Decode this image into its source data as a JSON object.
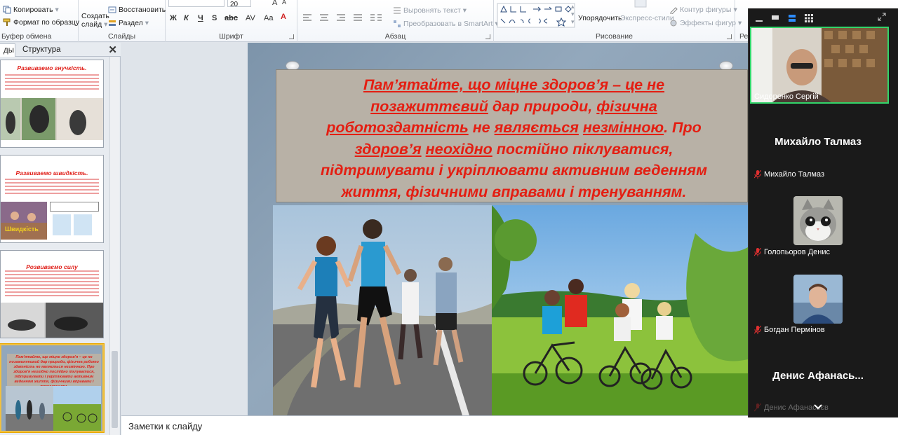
{
  "ribbon": {
    "clipboard": {
      "copy": "Копировать",
      "format_painter": "Формат по образцу",
      "label": "Буфер обмена"
    },
    "slides": {
      "new_slide": "Создать",
      "new_slide_2": "слайд",
      "restore": "Восстановить",
      "section": "Раздел",
      "label": "Слайды"
    },
    "font": {
      "size": "20",
      "label": "Шрифт"
    },
    "paragraph": {
      "align_text": "Выровнять текст",
      "convert_smartart": "Преобразовать в SmartArt",
      "label": "Абзац"
    },
    "drawing": {
      "arrange": "Упорядочить",
      "quick_styles": "Экспресс-стили",
      "shape_outline": "Контур фигуры",
      "shape_effects": "Эффекты фигур",
      "label": "Рисование"
    },
    "editing": {
      "label": "Ре"
    }
  },
  "left_panel": {
    "tab_slides": "ды",
    "tab_outline": "Структура",
    "thumbnails": [
      {
        "title": "Развиваемо гнучкість."
      },
      {
        "title": "Развиваемо швидкість.",
        "caption": "Швидкість"
      },
      {
        "title": "Розвиваємо силу"
      },
      {
        "title": "Пам'ятайте, що міцне здоров'я – це не позажиттєвий дар природи, фізична робото здатність не являється незмінною. Про здоров'я неохідно постійно піклуватися, підтримувати і укріплювати активним веденням життя, фізичними вправами і тренуванням."
      }
    ]
  },
  "slide": {
    "line1_a": "Пам’ятайте, що міцне здоров’я – це не",
    "line2_a": "позажиттєвий",
    "line2_b": " дар природи, ",
    "line2_c": "фізична",
    "line3_a": "роботоздатність",
    "line3_b": " не ",
    "line3_c": "являється",
    "line3_d": " ",
    "line3_e": "незмінною",
    "line3_f": ". Про",
    "line4_a": "здоров’я",
    "line4_b": " ",
    "line4_c": "неохідно",
    "line4_d": " постійно піклуватися,",
    "line5_a": "підтримувати і укріплювати активним веденням",
    "line6_a": "життя, фізичними вправами і тренуванням."
  },
  "notes": {
    "placeholder": "Заметки к слайду"
  },
  "zoom": {
    "participants": [
      {
        "name": "Сидоренко Сергій",
        "video": true
      },
      {
        "display": "Михайло Талмаз",
        "name": "Михайло Талмаз",
        "muted": true
      },
      {
        "name": "Голопьоров Денис",
        "muted": true
      },
      {
        "name": "Богдан Пермінов",
        "muted": true
      },
      {
        "display": "Денис  Афанась...",
        "name": "Денис Афанасьєв",
        "muted": true
      }
    ]
  },
  "colors": {
    "slide_text": "#e41e12",
    "active_speaker": "#32d46a",
    "zoom_bg": "#1a1a1a"
  }
}
